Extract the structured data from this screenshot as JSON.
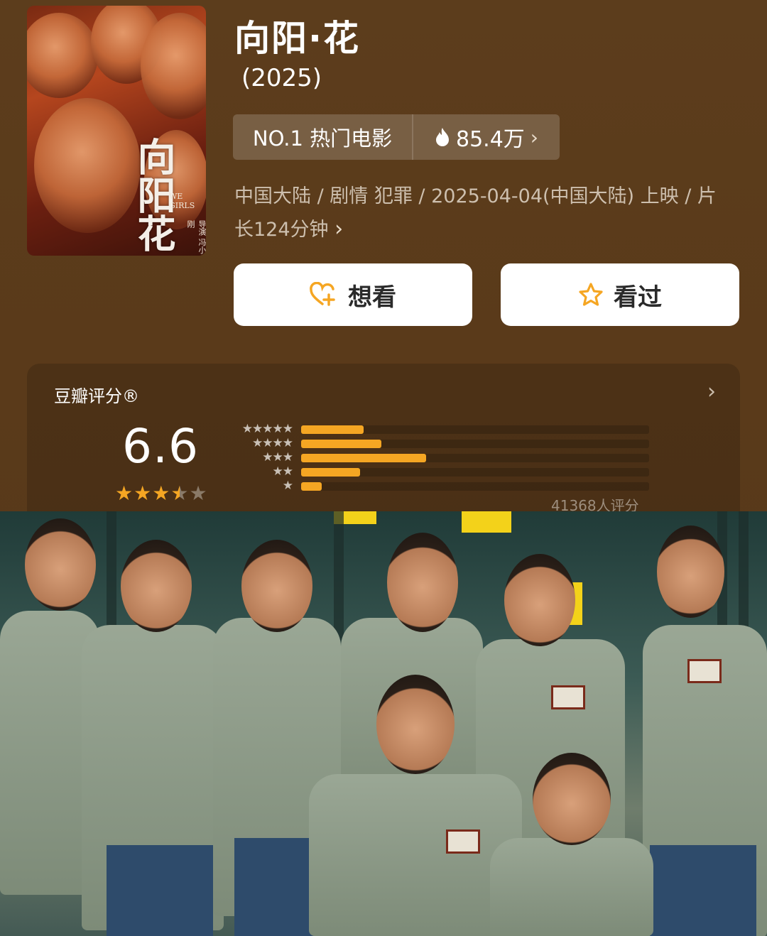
{
  "movie": {
    "title": "向阳·花",
    "year": "(2025)",
    "rank_label": "NO.1 热门电影",
    "heat": "85.4万",
    "meta": "中国大陆 / 剧情 犯罪 / 2025-04-04(中国大陆) 上映 / 片长124分钟",
    "poster": {
      "title_calligraphy": "向阳花",
      "english": "WE GIRLS",
      "director": "导演 冯小刚"
    }
  },
  "actions": {
    "want_label": "想看",
    "seen_label": "看过"
  },
  "rating": {
    "section_title": "豆瓣评分®",
    "score": "6.6",
    "stars": 3.5,
    "count_text": "41368人评分",
    "distribution": [
      {
        "stars": 5,
        "percent": 18
      },
      {
        "stars": 4,
        "percent": 23
      },
      {
        "stars": 3,
        "percent": 36
      },
      {
        "stars": 2,
        "percent": 17
      },
      {
        "stars": 1,
        "percent": 6
      }
    ]
  },
  "colors": {
    "accent": "#f5a623",
    "background": "#5a3a1a"
  },
  "icons": {
    "want": "heart-plus-icon",
    "seen": "star-outline-icon",
    "heat": "flame-icon"
  }
}
